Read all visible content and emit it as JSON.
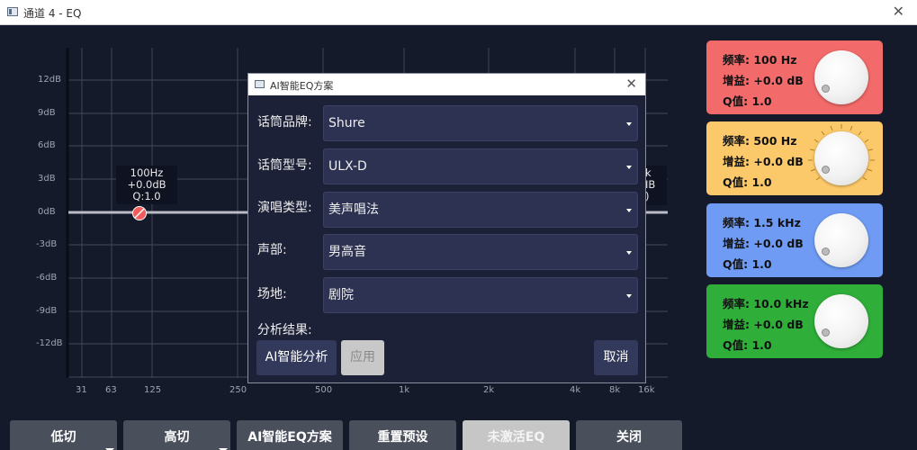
{
  "window": {
    "title": "通道 4 - EQ",
    "close_icon": "close-icon"
  },
  "graph": {
    "y_ticks": [
      "12dB",
      "9dB",
      "6dB",
      "3dB",
      "0dB",
      "-3dB",
      "-6dB",
      "-9dB",
      "-12dB"
    ],
    "x_ticks": [
      "31",
      "63",
      "125",
      "250",
      "500",
      "1k",
      "2k",
      "4k",
      "8k",
      "16k"
    ],
    "point_label": {
      "freq": "100Hz",
      "gain": "+0.0dB",
      "q": "Q:1.0"
    },
    "side_label": {
      "l1": "k",
      "l2": "IB",
      "l3": ")"
    }
  },
  "bands": [
    {
      "freq": "频率: 100 Hz",
      "gain": "增益: +0.0 dB",
      "q": "Q值: 1.0",
      "color": "#f26a6a"
    },
    {
      "freq": "频率: 500 Hz",
      "gain": "增益: +0.0 dB",
      "q": "Q值: 1.0",
      "color": "#fcc96a"
    },
    {
      "freq": "频率: 1.5 kHz",
      "gain": "增益: +0.0 dB",
      "q": "Q值: 1.0",
      "color": "#6f9bf4"
    },
    {
      "freq": "频率: 10.0 kHz",
      "gain": "增益: +0.0 dB",
      "q": "Q值: 1.0",
      "color": "#2fae3a"
    }
  ],
  "buttons": {
    "low_cut": "低切",
    "high_cut": "高切",
    "ai_eq": "AI智能EQ方案",
    "reset": "重置预设",
    "inactive_eq": "未激活EQ",
    "close": "关闭"
  },
  "dialog": {
    "title": "AI智能EQ方案",
    "brand_label": "话筒品牌:",
    "brand_value": "Shure",
    "model_label": "话筒型号:",
    "model_value": "ULX-D",
    "style_label": "演唱类型:",
    "style_value": "美声唱法",
    "voice_label": "声部:",
    "voice_value": "男高音",
    "venue_label": "场地:",
    "venue_value": "剧院",
    "result_label": "分析结果:",
    "analyze_btn": "AI智能分析",
    "apply_btn": "应用",
    "cancel_btn": "取消"
  }
}
